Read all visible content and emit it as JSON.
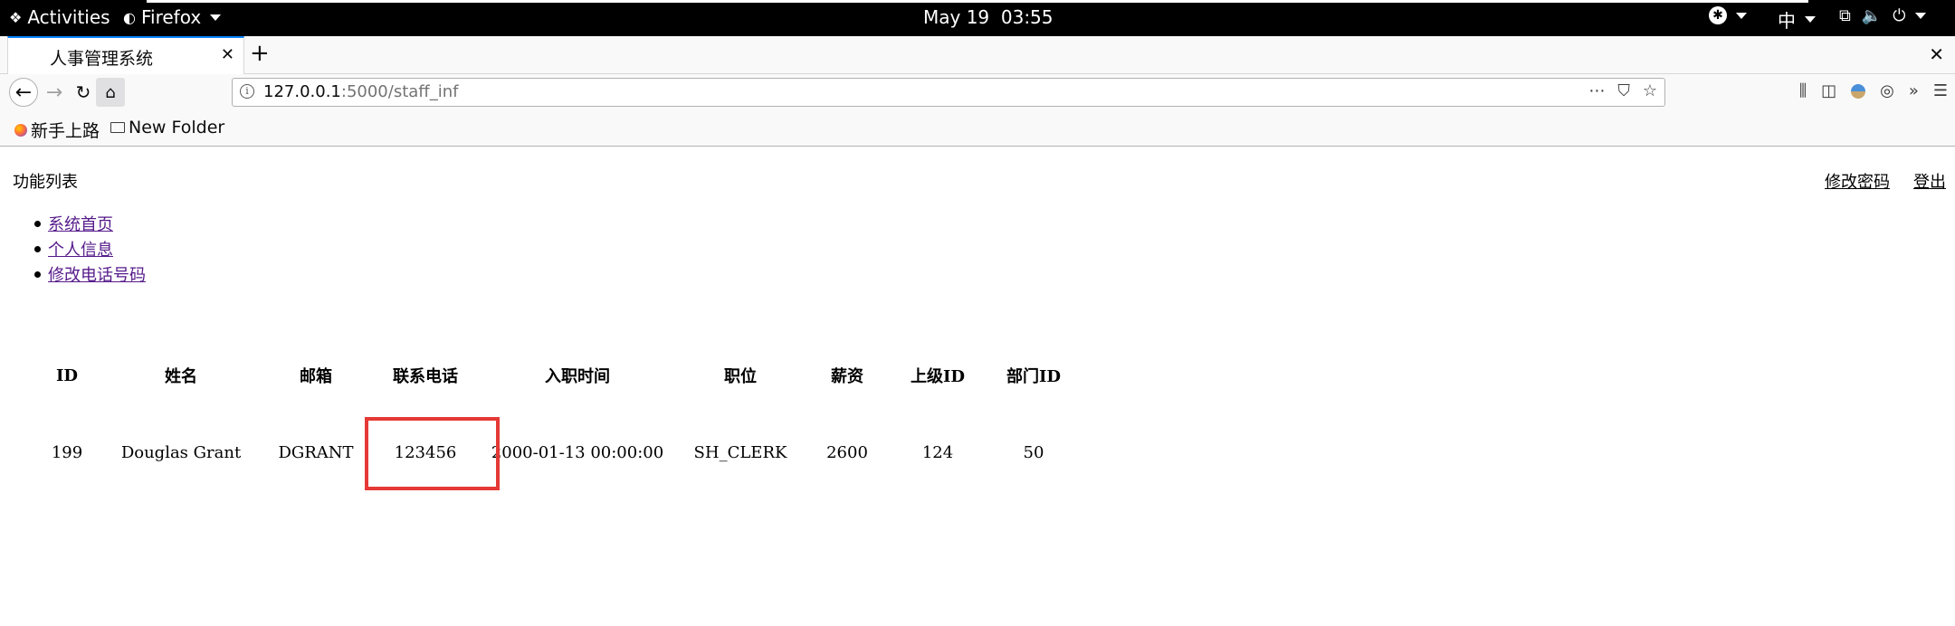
{
  "topbar": {
    "activities": "Activities",
    "app_name": "Firefox",
    "clock": "May 19  03:55",
    "ime": "中"
  },
  "browser": {
    "tab_title": "人事管理系统",
    "url_host": "127.0.0.1",
    "url_path": ":5000/staff_inf",
    "bookmarks": [
      {
        "label": "新手上路",
        "icon": "firefox-icon"
      },
      {
        "label": "New Folder",
        "icon": "folder-icon"
      }
    ]
  },
  "page": {
    "func_title": "功能列表",
    "change_password": "修改密码",
    "logout": "登出",
    "menu": [
      {
        "label": "系统首页"
      },
      {
        "label": "个人信息"
      },
      {
        "label": "修改电话号码"
      }
    ],
    "table": {
      "headers": [
        "ID",
        "姓名",
        "邮箱",
        "联系电话",
        "入职时间",
        "职位",
        "薪资",
        "上级ID",
        "部门ID"
      ],
      "rows": [
        [
          "199",
          "Douglas Grant",
          "DGRANT",
          "123456",
          "2000-01-13 00:00:00",
          "SH_CLERK",
          "2600",
          "124",
          "50"
        ]
      ]
    }
  },
  "colors": {
    "highlight_box": "#e53935",
    "visited_link": "#551a8b"
  }
}
